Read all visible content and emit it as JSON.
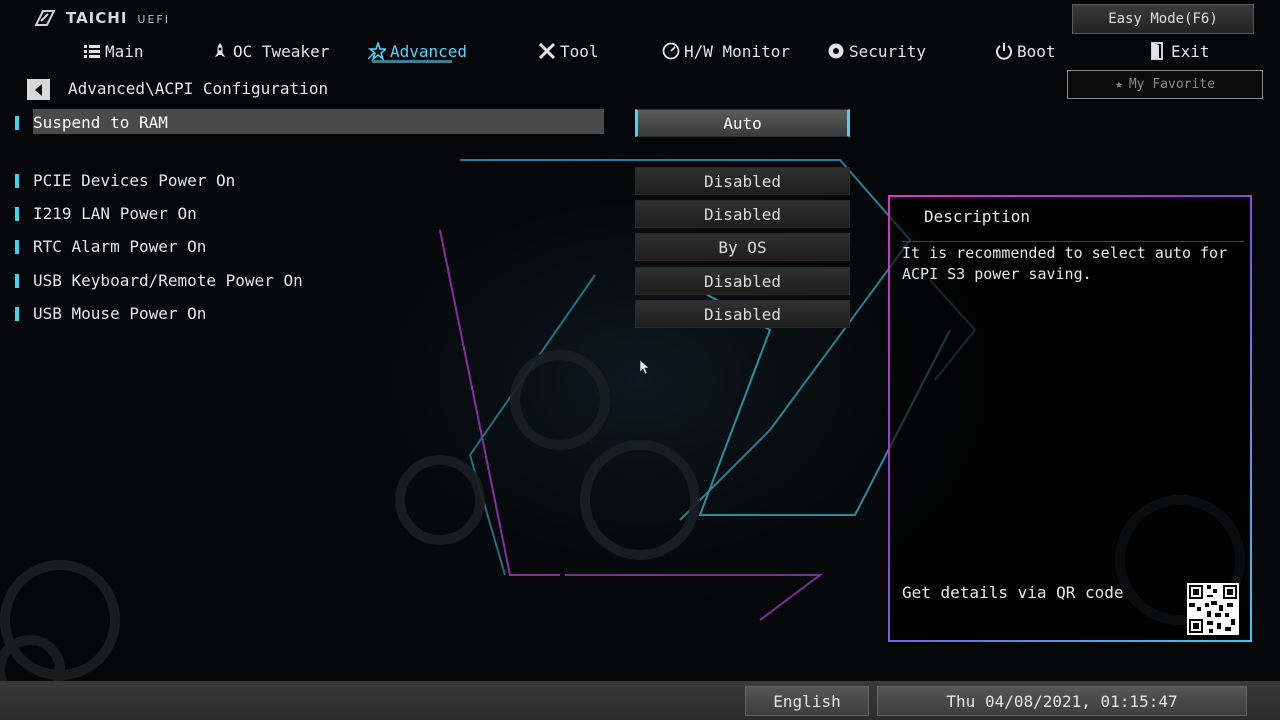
{
  "brand": {
    "name": "TAICHI",
    "sub": "UEFI"
  },
  "easy_mode": "Easy Mode(F6)",
  "favorite": "My Favorite",
  "nav": [
    {
      "label": "Main",
      "icon": "list-icon"
    },
    {
      "label": "OC Tweaker",
      "icon": "rocket-icon"
    },
    {
      "label": "Advanced",
      "icon": "star-icon",
      "active": true
    },
    {
      "label": "Tool",
      "icon": "tools-icon"
    },
    {
      "label": "H/W Monitor",
      "icon": "monitor-icon"
    },
    {
      "label": "Security",
      "icon": "shield-icon"
    },
    {
      "label": "Boot",
      "icon": "power-icon"
    },
    {
      "label": "Exit",
      "icon": "exit-icon"
    }
  ],
  "breadcrumb": "Advanced\\ACPI Configuration",
  "settings": [
    {
      "label": "Suspend to RAM",
      "value": "Auto",
      "selected": true
    },
    {
      "label": "PCIE Devices Power On",
      "value": "Disabled"
    },
    {
      "label": "I219 LAN Power On",
      "value": "Disabled"
    },
    {
      "label": "RTC Alarm Power On",
      "value": "By OS"
    },
    {
      "label": "USB Keyboard/Remote Power On",
      "value": "Disabled"
    },
    {
      "label": "USB Mouse Power On",
      "value": "Disabled"
    }
  ],
  "description": {
    "title": "Description",
    "text": "It is recommended to select auto for ACPI S3 power saving.",
    "qr_label": "Get details via QR code"
  },
  "status": {
    "language": "English",
    "datetime": "Thu 04/08/2021, 01:15:47"
  },
  "colors": {
    "accent": "#4fd8ff",
    "panel_border_start": "#e030d0",
    "panel_border_end": "#3ac9f0"
  }
}
